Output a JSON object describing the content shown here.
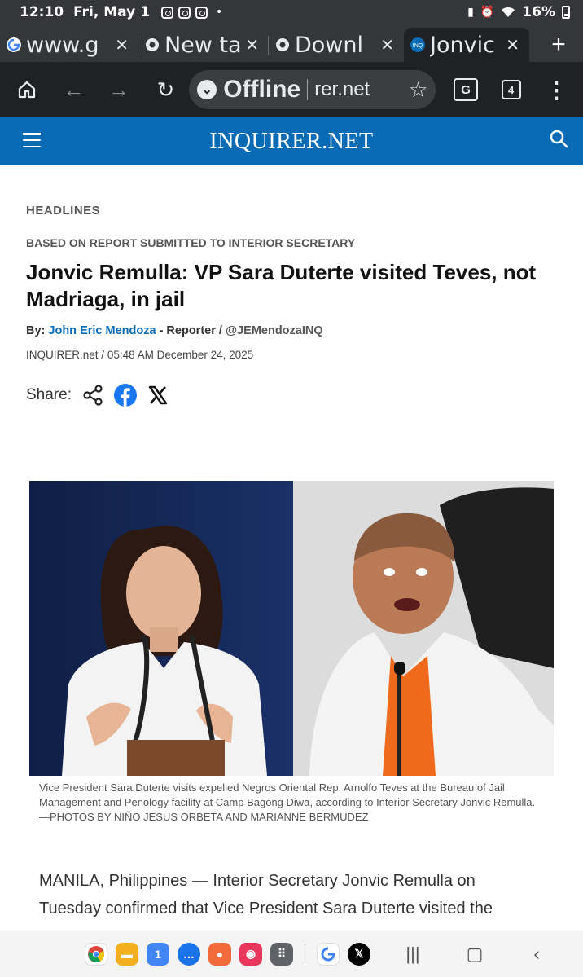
{
  "status_bar": {
    "time": "12:10",
    "date": "Fri, May 1",
    "battery": "16%"
  },
  "tabs": [
    {
      "title": "www.g",
      "favicon": "google-icon"
    },
    {
      "title": "New ta",
      "favicon": "chrome-icon"
    },
    {
      "title": "Downl",
      "favicon": "chrome-icon"
    },
    {
      "title": "Jonvic",
      "favicon": "inquirer-icon",
      "active": true
    }
  ],
  "toolbar": {
    "offline_label": "Offline",
    "url": "rer.net",
    "tab_count": "4"
  },
  "site": {
    "logo": "INQUIRER.NET"
  },
  "article": {
    "section": "HEADLINES",
    "kicker": "BASED ON REPORT SUBMITTED TO INTERIOR SECRETARY",
    "headline": "Jonvic Remulla: VP Sara Duterte visited Teves, not Madriaga, in jail",
    "by_label": "By:",
    "author": "John Eric Mendoza",
    "role": "- Reporter /",
    "handle": "@JEMendozaINQ",
    "source": "INQUIRER.net",
    "date_sep": "/",
    "datetime": "05:48 AM December 24, 2025",
    "share_label": "Share:",
    "caption": "Vice President Sara Duterte visits expelled Negros Oriental Rep. Arnolfo Teves at the Bureau of Jail Management and Penology facility at Camp Bagong Diwa, according to Interior Secretary Jonvic Remulla. —PHOTOS BY NIÑO JESUS ORBETA AND MARIANNE BERMUDEZ",
    "body_line1": "MANILA, Philippines — Interior Secretary Jonvic Remulla on",
    "body_line2": "Tuesday confirmed that Vice President Sara Duterte visited the"
  },
  "nav_apps": [
    {
      "name": "chrome-icon",
      "color": "#db4437"
    },
    {
      "name": "files-icon",
      "color": "#f2b01e"
    },
    {
      "name": "calendar-icon",
      "color": "#4285f4",
      "label": "1"
    },
    {
      "name": "messages-icon",
      "color": "#1a73e8"
    },
    {
      "name": "contacts-icon",
      "color": "#f26b3a"
    },
    {
      "name": "camera-icon",
      "color": "#e8365d"
    },
    {
      "name": "apps-icon",
      "color": "#5f6368"
    },
    {
      "name": "google-icon",
      "color": "#ffffff"
    },
    {
      "name": "x-app-icon",
      "color": "#000000"
    }
  ]
}
